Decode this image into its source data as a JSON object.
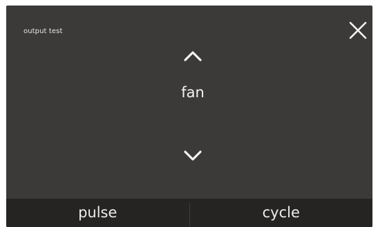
{
  "screen": {
    "title": "output test",
    "value": "fan"
  },
  "controls": {
    "close_icon": "close-icon",
    "up_icon": "chevron-up-icon",
    "down_icon": "chevron-down-icon"
  },
  "bottom_bar": {
    "left_label": "pulse",
    "right_label": "cycle"
  },
  "colors": {
    "screen_background": "#3b3a38",
    "bar_background": "#252423",
    "text": "#f2f2f2"
  }
}
